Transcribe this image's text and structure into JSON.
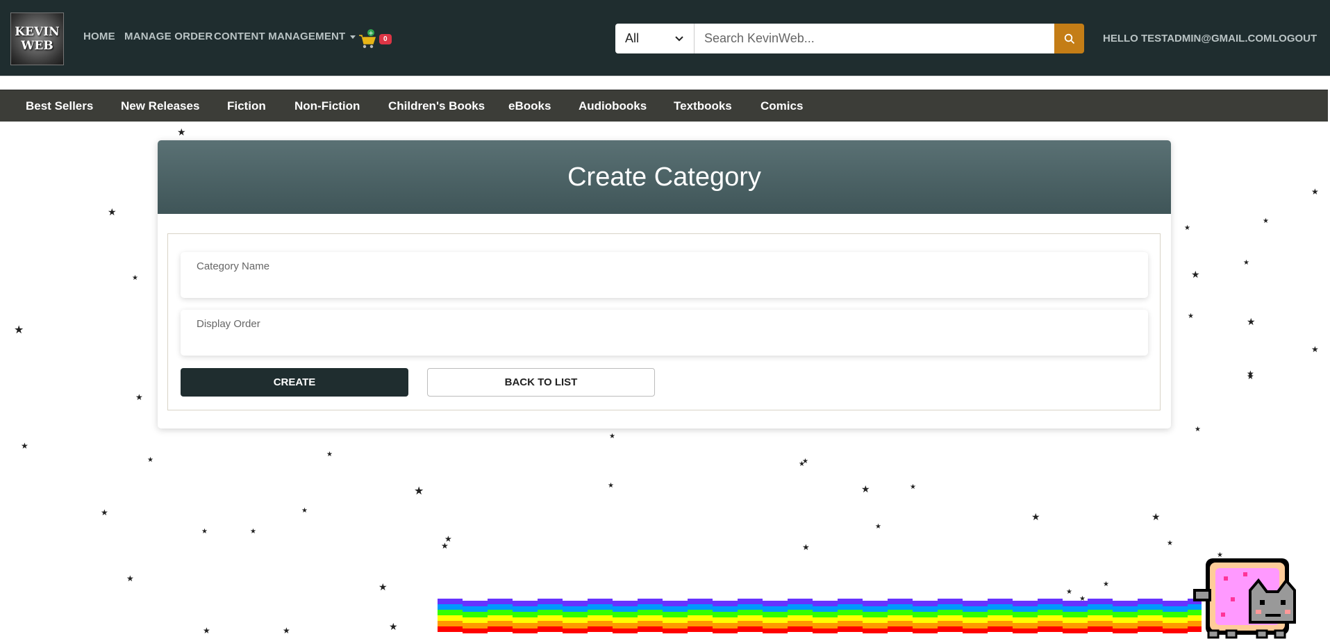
{
  "header": {
    "logo_line1": "KEVIN",
    "logo_line2": "WEB",
    "nav": [
      "HOME",
      "MANAGE ORDER",
      "CONTENT MANAGEMENT"
    ],
    "cart_count": "0",
    "search": {
      "category": "All",
      "placeholder": "Search KevinWeb..."
    },
    "greeting": "HELLO TESTADMIN@GMAIL.COM!",
    "logout": "LOGOUT"
  },
  "categories": [
    "Best Sellers",
    "New Releases",
    "Fiction",
    "Non-Fiction",
    "Children's Books",
    "eBooks",
    "Audiobooks",
    "Textbooks",
    "Comics"
  ],
  "form": {
    "title": "Create Category",
    "category_name_label": "Category Name",
    "display_order_label": "Display Order",
    "create_label": "CREATE",
    "back_label": "BACK TO LIST"
  },
  "colors": {
    "navbar": "#1f2d2f",
    "category_bar": "#3c3d38",
    "search_button": "#c47d16",
    "cart_badge": "#dc3545"
  }
}
